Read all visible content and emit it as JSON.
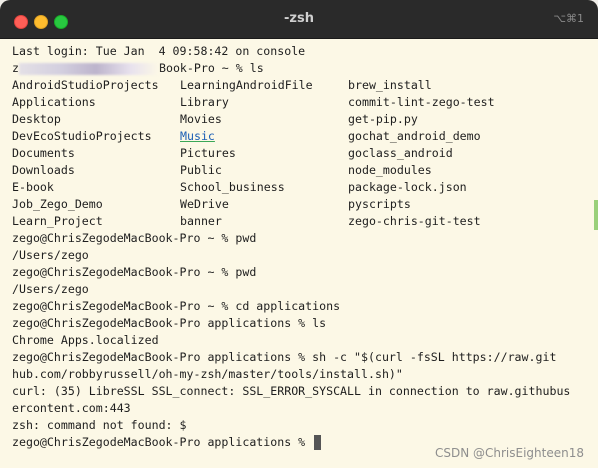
{
  "window": {
    "title": "-zsh",
    "shortcut": "⌥⌘1"
  },
  "terminal": {
    "last_login": "Last login: Tue Jan  4 09:58:42 on console",
    "first_prompt_prefix": "z",
    "first_prompt_suffix": "Book-Pro ~ % ls",
    "ls_rows": [
      [
        "AndroidStudioProjects",
        "LearningAndroidFile",
        "brew_install"
      ],
      [
        "Applications",
        "Library",
        "commit-lint-zego-test"
      ],
      [
        "Desktop",
        "Movies",
        "get-pip.py"
      ],
      [
        "DevEcoStudioProjects",
        "Music",
        "gochat_android_demo"
      ],
      [
        "Documents",
        "Pictures",
        "goclass_android"
      ],
      [
        "Downloads",
        "Public",
        "node_modules"
      ],
      [
        "E-book",
        "School_business",
        "package-lock.json"
      ],
      [
        "Job_Zego_Demo",
        "WeDrive",
        "pyscripts"
      ],
      [
        "Learn_Project",
        "banner",
        "zego-chris-git-test"
      ]
    ],
    "lines_after": [
      "zego@ChrisZegodeMacBook-Pro ~ % pwd",
      "/Users/zego",
      "zego@ChrisZegodeMacBook-Pro ~ % pwd",
      "/Users/zego",
      "zego@ChrisZegodeMacBook-Pro ~ % cd applications",
      "zego@ChrisZegodeMacBook-Pro applications % ls",
      "Chrome Apps.localized",
      "zego@ChrisZegodeMacBook-Pro applications % sh -c \"$(curl -fsSL https://raw.git",
      "hub.com/robbyrussell/oh-my-zsh/master/tools/install.sh)\"",
      "curl: (35) LibreSSL SSL_connect: SSL_ERROR_SYSCALL in connection to raw.githubus",
      "ercontent.com:443",
      "zsh: command not found: $"
    ],
    "final_prompt": "zego@ChrisZegodeMacBook-Pro applications % "
  },
  "watermark": "CSDN @ChrisEighteen18"
}
